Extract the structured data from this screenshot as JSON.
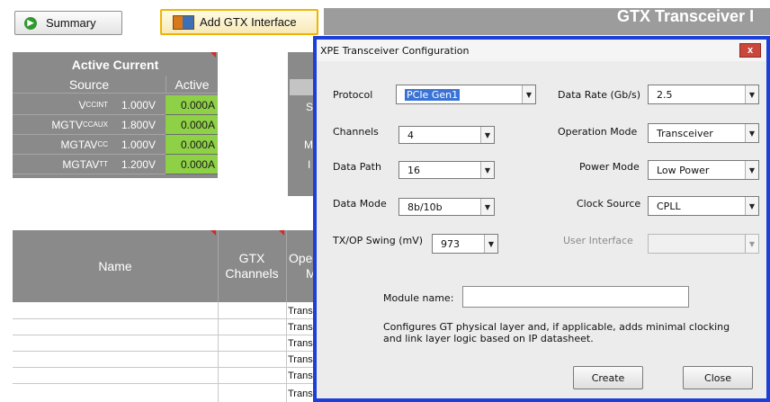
{
  "toolbar": {
    "summary_label": "Summary",
    "add_label": "Add GTX Interface",
    "header_title": "GTX Transceiver I"
  },
  "active_current": {
    "title": "Active Current",
    "source_header": "Source",
    "active_header": "Active",
    "rows": [
      {
        "name": "V",
        "sub": "CCINT",
        "voltage": "1.000V",
        "active": "0.000A"
      },
      {
        "name": "MGTV",
        "sub": "CCAUX",
        "voltage": "1.800V",
        "active": "0.000A"
      },
      {
        "name": "MGTAV",
        "sub": "CC",
        "voltage": "1.000V",
        "active": "0.000A"
      },
      {
        "name": "MGTAV",
        "sub": "TT",
        "voltage": "1.200V",
        "active": "0.000A"
      }
    ],
    "partial_labels": [
      "S",
      "M",
      "I"
    ]
  },
  "table": {
    "name_header": "Name",
    "gtx_header": "GTX",
    "channels_header": "Channels",
    "op_header": "Ope",
    "op_sub": "M",
    "row_values": [
      "Trans",
      "Trans",
      "Trans",
      "Trans",
      "Trans",
      "Trans"
    ]
  },
  "dialog": {
    "title": "XPE Transceiver Configuration",
    "close_glyph": "x",
    "fields": {
      "protocol": {
        "label": "Protocol",
        "value": "PCIe Gen1"
      },
      "channels": {
        "label": "Channels",
        "value": "4"
      },
      "data_path": {
        "label": "Data Path",
        "value": "16"
      },
      "data_mode": {
        "label": "Data Mode",
        "value": "8b/10b"
      },
      "tx_swing": {
        "label": "TX/OP Swing (mV)",
        "value": "973"
      },
      "data_rate": {
        "label": "Data Rate (Gb/s)",
        "value": "2.5"
      },
      "operation_mode": {
        "label": "Operation Mode",
        "value": "Transceiver"
      },
      "power_mode": {
        "label": "Power Mode",
        "value": "Low Power"
      },
      "clock_source": {
        "label": "Clock Source",
        "value": "CPLL"
      },
      "user_interface": {
        "label": "User Interface",
        "value": ""
      }
    },
    "module_name_label": "Module name:",
    "module_name_value": "",
    "description_line1": "Configures GT physical layer and, if applicable, adds minimal clocking",
    "description_line2": "and link layer logic based on IP datasheet.",
    "create_label": "Create",
    "close_label": "Close"
  }
}
